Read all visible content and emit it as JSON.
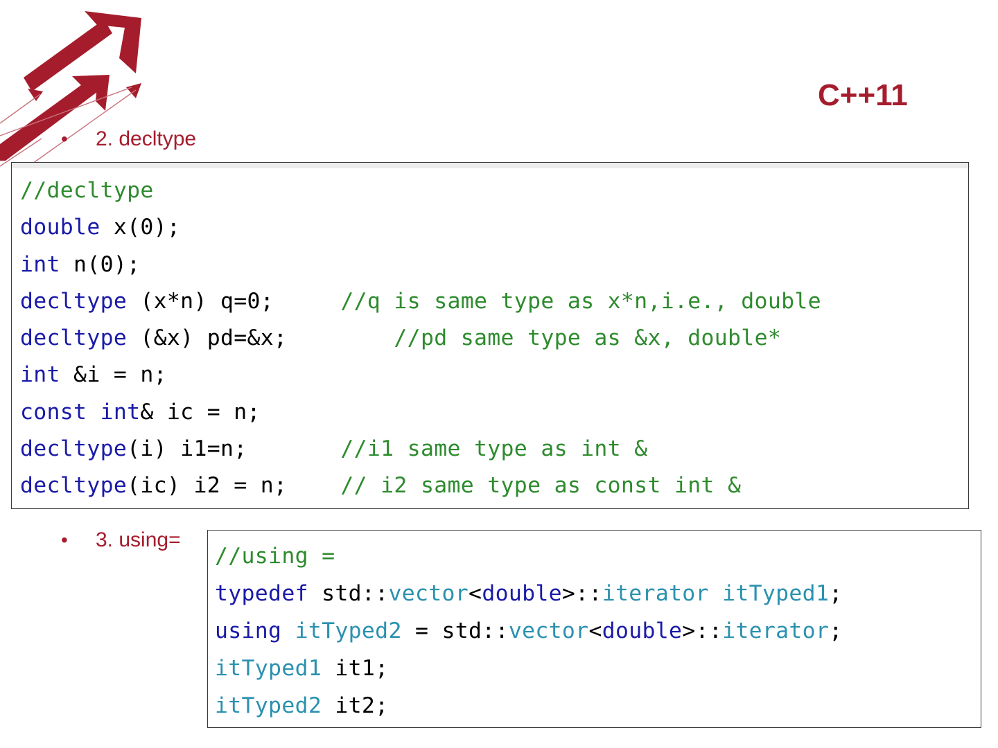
{
  "slide": {
    "title": "C++11",
    "bullets": [
      {
        "label": "2. decltype"
      },
      {
        "label": "3. using="
      }
    ]
  },
  "colors": {
    "accent": "#a51d2d",
    "comment": "#2e8b2e",
    "keyword": "#1a1aa8",
    "type_name": "#2b91af"
  },
  "icons": {
    "logo": "red-arrows-logo",
    "bullet": "bullet-dot"
  },
  "code_blocks": [
    {
      "lines": [
        [
          {
            "t": "//decltype",
            "c": "cm"
          }
        ],
        [
          {
            "t": "double",
            "c": "kw"
          },
          {
            "t": " x(0);"
          }
        ],
        [
          {
            "t": "int",
            "c": "kw"
          },
          {
            "t": " n(0);"
          }
        ],
        [
          {
            "t": "decltype",
            "c": "kw"
          },
          {
            "t": " (x*n) q=0;     "
          },
          {
            "t": "//q is same type as x*n,i.e., double",
            "c": "cm"
          }
        ],
        [
          {
            "t": "decltype",
            "c": "kw"
          },
          {
            "t": " (&x) pd=&x;        "
          },
          {
            "t": "//pd same type as &x, double*",
            "c": "cm"
          }
        ],
        [
          {
            "t": "int",
            "c": "kw"
          },
          {
            "t": " &i = n;"
          }
        ],
        [
          {
            "t": "const",
            "c": "kw"
          },
          {
            "t": " "
          },
          {
            "t": "int",
            "c": "kw"
          },
          {
            "t": "& ic = n;"
          }
        ],
        [
          {
            "t": "decltype",
            "c": "kw"
          },
          {
            "t": "(i) i1=n;       "
          },
          {
            "t": "//i1 same type as int &",
            "c": "cm"
          }
        ],
        [
          {
            "t": "decltype",
            "c": "kw"
          },
          {
            "t": "(ic) i2 = n;    "
          },
          {
            "t": "// i2 same type as const int &",
            "c": "cm"
          }
        ]
      ]
    },
    {
      "lines": [
        [
          {
            "t": "//using =",
            "c": "cm"
          }
        ],
        [
          {
            "t": "typedef",
            "c": "kw"
          },
          {
            "t": " std::"
          },
          {
            "t": "vector",
            "c": "ty"
          },
          {
            "t": "<"
          },
          {
            "t": "double",
            "c": "kw"
          },
          {
            "t": ">::"
          },
          {
            "t": "iterator",
            "c": "ty"
          },
          {
            "t": " "
          },
          {
            "t": "itTyped1",
            "c": "ty"
          },
          {
            "t": ";"
          }
        ],
        [
          {
            "t": "using",
            "c": "kw"
          },
          {
            "t": " "
          },
          {
            "t": "itTyped2",
            "c": "ty"
          },
          {
            "t": " = std::"
          },
          {
            "t": "vector",
            "c": "ty"
          },
          {
            "t": "<"
          },
          {
            "t": "double",
            "c": "kw"
          },
          {
            "t": ">::"
          },
          {
            "t": "iterator",
            "c": "ty"
          },
          {
            "t": ";"
          }
        ],
        [
          {
            "t": "itTyped1",
            "c": "ty"
          },
          {
            "t": " it1;"
          }
        ],
        [
          {
            "t": "itTyped2",
            "c": "ty"
          },
          {
            "t": " it2;"
          }
        ]
      ]
    }
  ]
}
